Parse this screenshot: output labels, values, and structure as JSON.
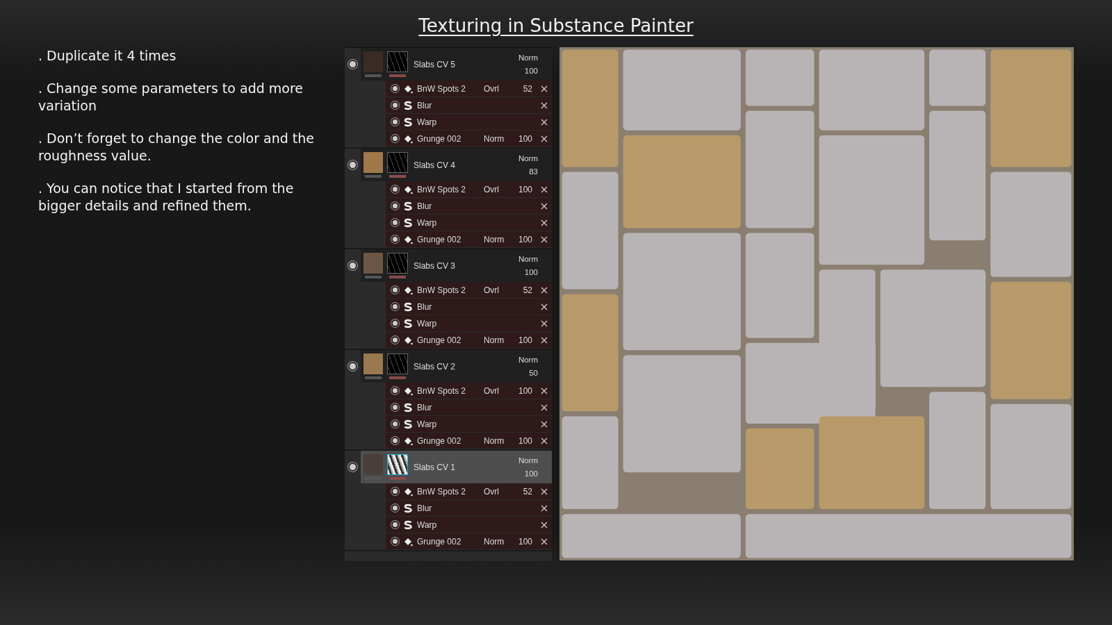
{
  "title": "Texturing in Substance Painter",
  "notes": [
    ". Duplicate it 4 times",
    ". Change some parameters to add more variation",
    ". Don’t forget to change the color and the roughness value.",
    ". You can notice that I started from the bigger details and refined them."
  ],
  "layers": [
    {
      "name": "Slabs CV 5",
      "blend": "Norm",
      "opacity": "100",
      "color": "#3a2c24",
      "selected": false,
      "effects": [
        {
          "kind": "fill",
          "name": "BnW Spots 2",
          "blend": "Ovrl",
          "opacity": "52"
        },
        {
          "kind": "filter",
          "name": "Blur"
        },
        {
          "kind": "filter",
          "name": "Warp"
        },
        {
          "kind": "fill",
          "name": "Grunge 002",
          "blend": "Norm",
          "opacity": "100"
        }
      ]
    },
    {
      "name": "Slabs CV 4",
      "blend": "Norm",
      "opacity": "83",
      "color": "#a0784a",
      "selected": false,
      "effects": [
        {
          "kind": "fill",
          "name": "BnW Spots 2",
          "blend": "Ovrl",
          "opacity": "100"
        },
        {
          "kind": "filter",
          "name": "Blur"
        },
        {
          "kind": "filter",
          "name": "Warp"
        },
        {
          "kind": "fill",
          "name": "Grunge 002",
          "blend": "Norm",
          "opacity": "100"
        }
      ]
    },
    {
      "name": "Slabs CV 3",
      "blend": "Norm",
      "opacity": "100",
      "color": "#6e5646",
      "selected": false,
      "effects": [
        {
          "kind": "fill",
          "name": "BnW Spots 2",
          "blend": "Ovrl",
          "opacity": "52"
        },
        {
          "kind": "filter",
          "name": "Blur"
        },
        {
          "kind": "filter",
          "name": "Warp"
        },
        {
          "kind": "fill",
          "name": "Grunge 002",
          "blend": "Norm",
          "opacity": "100"
        }
      ]
    },
    {
      "name": "Slabs CV 2",
      "blend": "Norm",
      "opacity": "50",
      "color": "#9a7850",
      "selected": false,
      "effects": [
        {
          "kind": "fill",
          "name": "BnW Spots 2",
          "blend": "Ovrl",
          "opacity": "100"
        },
        {
          "kind": "filter",
          "name": "Blur"
        },
        {
          "kind": "filter",
          "name": "Warp"
        },
        {
          "kind": "fill",
          "name": "Grunge 002",
          "blend": "Norm",
          "opacity": "100"
        }
      ]
    },
    {
      "name": "Slabs CV 1",
      "blend": "Norm",
      "opacity": "100",
      "color": "#4a3e38",
      "selected": true,
      "effects": [
        {
          "kind": "fill",
          "name": "BnW Spots 2",
          "blend": "Ovrl",
          "opacity": "52"
        },
        {
          "kind": "filter",
          "name": "Blur"
        },
        {
          "kind": "filter",
          "name": "Warp"
        },
        {
          "kind": "fill",
          "name": "Grunge 002",
          "blend": "Norm",
          "opacity": "100"
        }
      ]
    }
  ]
}
